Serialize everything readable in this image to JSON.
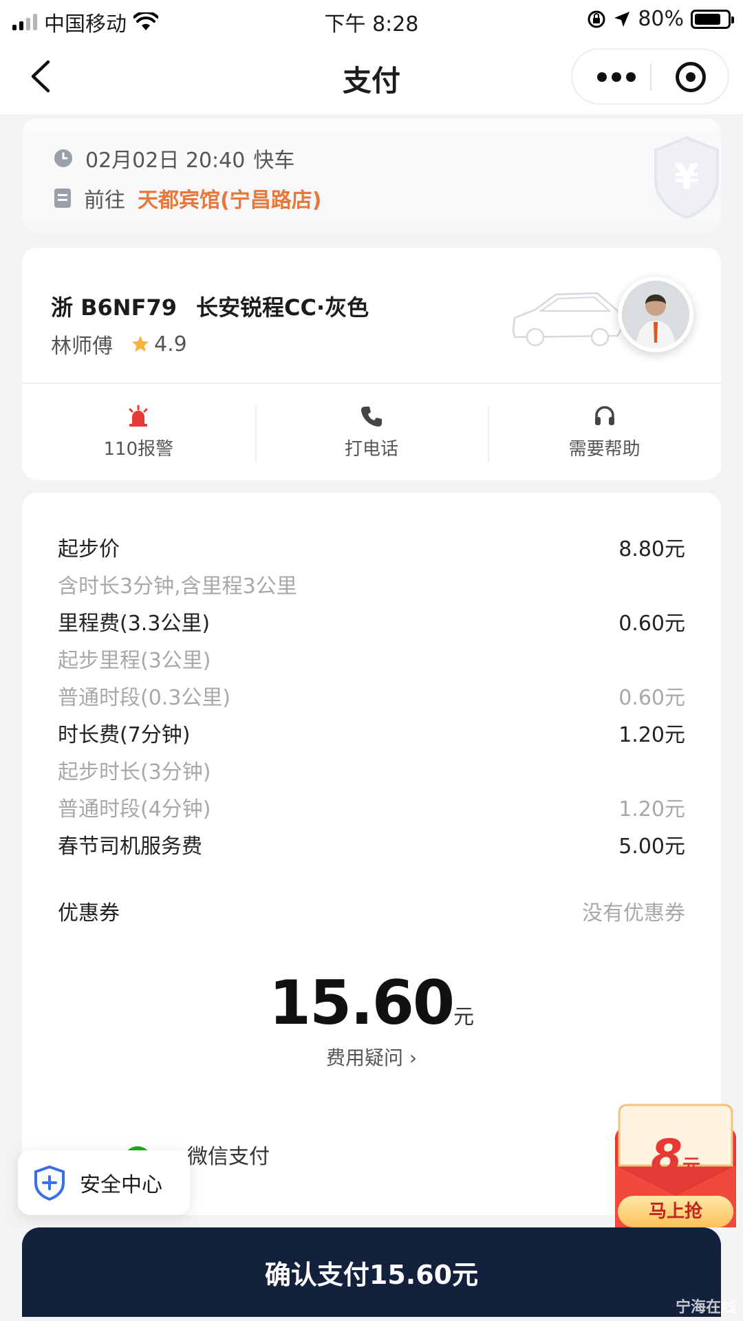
{
  "status_bar": {
    "carrier": "中国移动",
    "time": "下午 8:28",
    "battery": "80%",
    "battery_level": 0.8
  },
  "nav": {
    "title": "支付"
  },
  "trip": {
    "datetime": "02月02日 20:40",
    "service": "快车",
    "destination_prefix": "前往",
    "destination": "天都宾馆(宁昌路店)"
  },
  "driver": {
    "plate": "浙 B6NF79",
    "car": "长安锐程CC·灰色",
    "name": "林师傅",
    "rating": "4.9"
  },
  "actions": [
    {
      "label": "110报警",
      "icon": "alarm-icon"
    },
    {
      "label": "打电话",
      "icon": "phone-icon"
    },
    {
      "label": "需要帮助",
      "icon": "headset-icon"
    }
  ],
  "fees": [
    {
      "label": "起步价",
      "value": "8.80元",
      "type": "main"
    },
    {
      "label": "含时长3分钟,含里程3公里",
      "value": "",
      "type": "sub"
    },
    {
      "label": "里程费(3.3公里)",
      "value": "0.60元",
      "type": "main"
    },
    {
      "label": "起步里程(3公里)",
      "value": "",
      "type": "sub"
    },
    {
      "label": "普通时段(0.3公里)",
      "value": "0.60元",
      "type": "sub"
    },
    {
      "label": "时长费(7分钟)",
      "value": "1.20元",
      "type": "main"
    },
    {
      "label": "起步时长(3分钟)",
      "value": "",
      "type": "sub"
    },
    {
      "label": "普通时段(4分钟)",
      "value": "1.20元",
      "type": "sub"
    },
    {
      "label": "春节司机服务费",
      "value": "5.00元",
      "type": "main"
    }
  ],
  "coupon": {
    "label": "优惠券",
    "value": "没有优惠券"
  },
  "total": {
    "amount": "15.60",
    "unit": "元"
  },
  "fee_question": "费用疑问 ›",
  "payment_method": "微信支付",
  "safety_center": "安全中心",
  "red_envelope": {
    "amount": "8",
    "unit": "元",
    "button": "马上抢"
  },
  "confirm_button": "确认支付15.60元",
  "watermark": "宁海在线"
}
